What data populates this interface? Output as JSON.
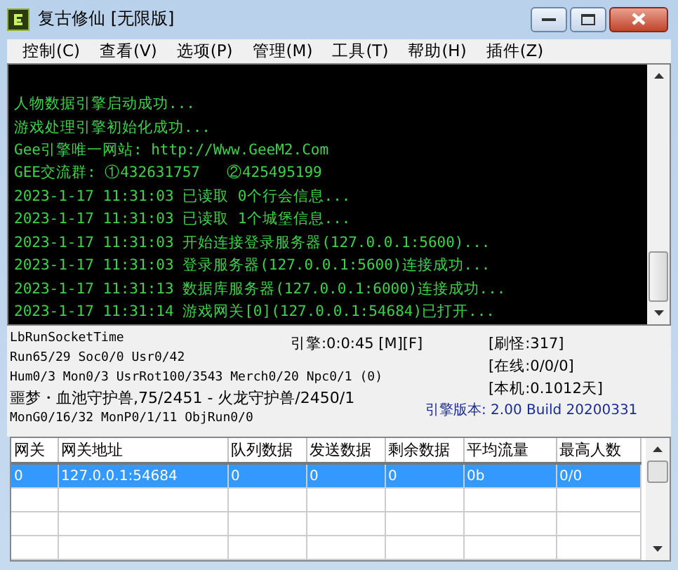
{
  "window": {
    "title": "复古修仙 [无限版]"
  },
  "menu": [
    "控制(C)",
    "查看(V)",
    "选项(P)",
    "管理(M)",
    "工具(T)",
    "帮助(H)",
    "插件(Z)"
  ],
  "log": [
    "人物数据引擎启动成功...",
    "游戏处理引擎初始化成功...",
    "Gee引擎唯一网站: http://Www.GeeM2.Com",
    "GEE交流群: ①432631757   ②425495199",
    "2023-1-17 11:31:03 已读取 0个行会信息...",
    "2023-1-17 11:31:03 已读取 1个城堡信息...",
    "2023-1-17 11:31:03 开始连接登录服务器(127.0.0.1:5600)...",
    "2023-1-17 11:31:03 登录服务器(127.0.0.1:5600)连接成功...",
    "2023-1-17 11:31:13 数据库服务器(127.0.0.1:6000)连接成功...",
    "2023-1-17 11:31:14 游戏网关[0](127.0.0.1:54684)已打开..."
  ],
  "status": {
    "left": [
      "LbRunSocketTime",
      "Run65/29 Soc0/0 Usr0/42",
      "Hum0/3 Mon0/3 UsrRot100/3543 Merch0/20 Npc0/1 (0)",
      "噩梦・血池守护兽,75/2451 - 火龙守护兽/2450/1",
      "MonG0/16/32 MonP0/1/11 ObjRun0/0"
    ],
    "engine": "引擎:0:0:45 [M][F]",
    "right": [
      "[刷怪:317]",
      "[在线:0/0/0]",
      "[本机:0.1012天]"
    ],
    "version": "引擎版本: 2.00 Build 20200331"
  },
  "table": {
    "columns": [
      "网关",
      "网关地址",
      "队列数据",
      "发送数据",
      "剩余数据",
      "平均流量",
      "最高人数"
    ],
    "rows": [
      {
        "selected": true,
        "cells": [
          "0",
          "127.0.0.1:54684",
          "0",
          "0",
          "0",
          "0b",
          "0/0"
        ]
      }
    ]
  }
}
